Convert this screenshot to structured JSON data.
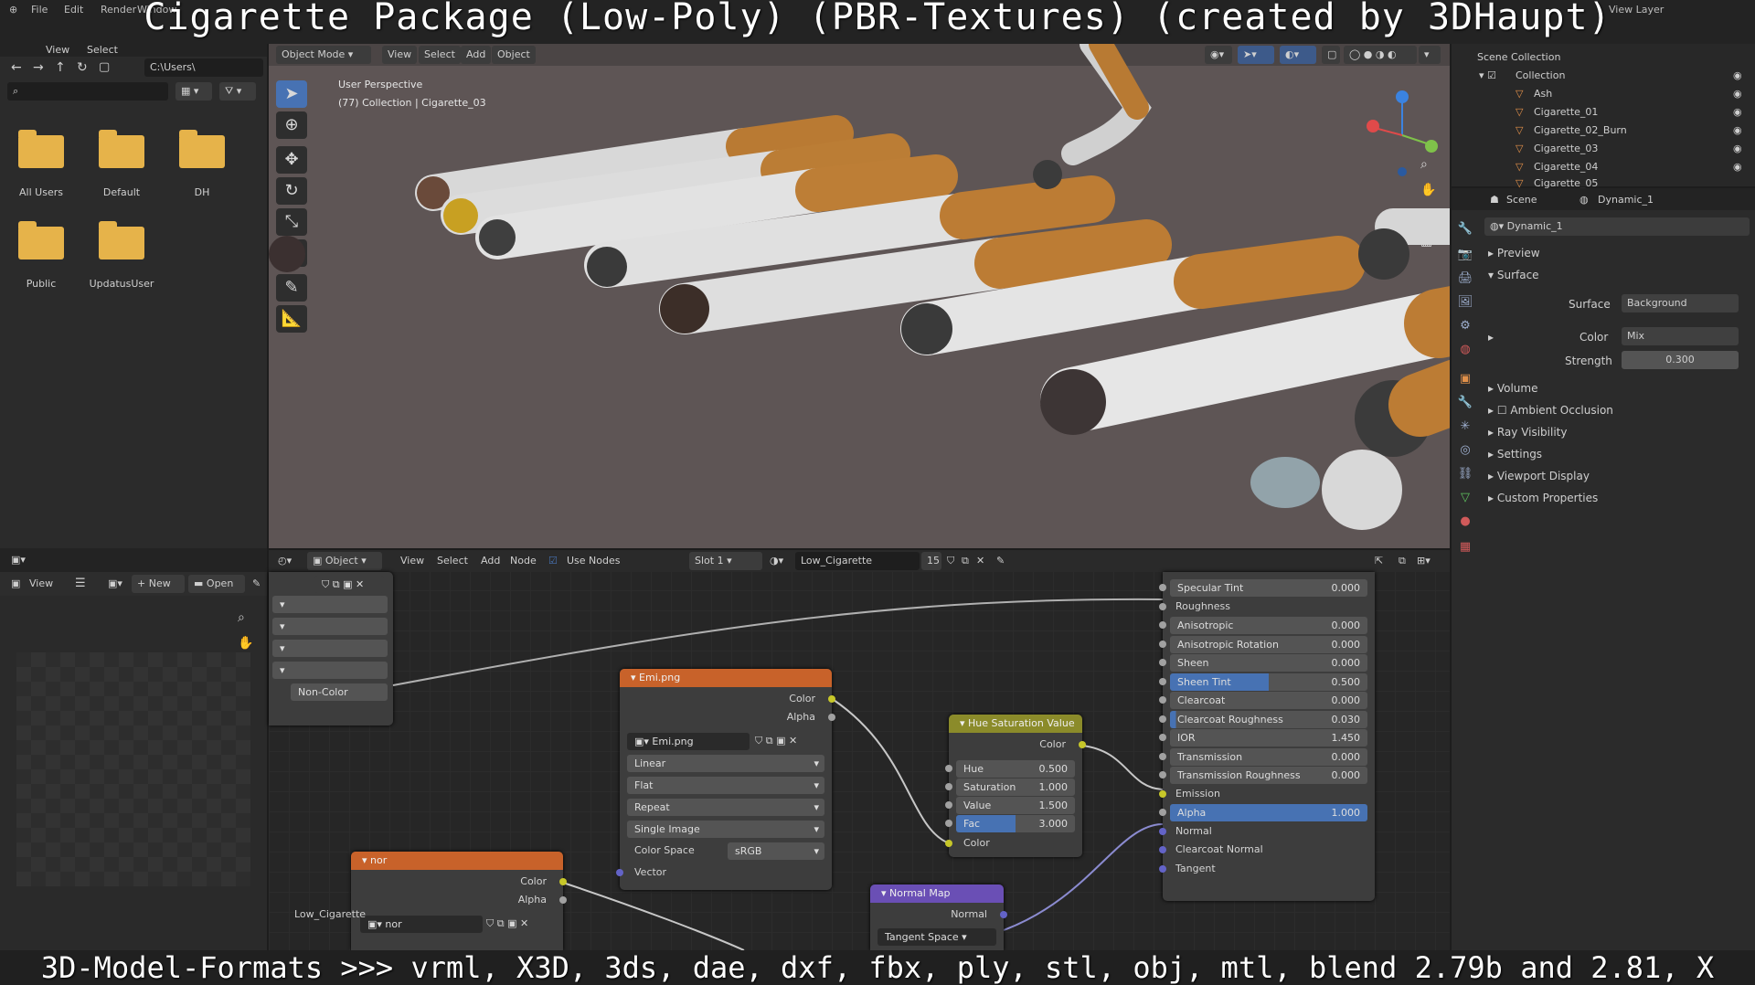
{
  "overlay_title": "Cigarette Package (Low-Poly) (PBR-Textures) (created by 3DHaupt)",
  "overlay_footer": "3D-Model-Formats >>> vrml, X3D, 3ds, dae, dxf, fbx, ply, stl, obj, mtl, blend 2.79b and 2.81, X",
  "topmenu": {
    "file": "File",
    "edit": "Edit",
    "render": "Render",
    "window": "Window",
    "view_layer": "View Layer"
  },
  "filebrowser": {
    "header": {
      "view": "View",
      "select": "Select"
    },
    "path": "C:\\Users\\",
    "folders": [
      "All Users",
      "Default",
      "DH",
      "Public",
      "UpdatusUser"
    ]
  },
  "viewport": {
    "mode": "Object Mode",
    "menus": [
      "View",
      "Select",
      "Add",
      "Object"
    ],
    "perspective": "User Perspective",
    "collection_info": "(77) Collection | Cigarette_03"
  },
  "outliner": {
    "root": "Scene Collection",
    "collection": "Collection",
    "items": [
      "Ash",
      "Cigarette_01",
      "Cigarette_02_Burn",
      "Cigarette_03",
      "Cigarette_04",
      "Cigarette_05"
    ]
  },
  "properties": {
    "scene_tab": "Scene",
    "world_tab": "Dynamic_1",
    "world_name": "Dynamic_1",
    "panels": {
      "preview": "Preview",
      "surface": "Surface",
      "volume": "Volume",
      "ao": "Ambient Occlusion",
      "ray": "Ray Visibility",
      "settings": "Settings",
      "viewport_display": "Viewport Display",
      "custom": "Custom Properties"
    },
    "surface_label": "Surface",
    "surface_value": "Background",
    "color_label": "Color",
    "color_value": "Mix",
    "strength_label": "Strength",
    "strength_value": "0.300"
  },
  "image_editor": {
    "view": "View",
    "new": "New",
    "open": "Open"
  },
  "node_editor": {
    "object": "Object",
    "menus": [
      "View",
      "Select",
      "Add",
      "Node"
    ],
    "use_nodes": "Use Nodes",
    "slot": "Slot 1",
    "material": "Low_Cigarette",
    "users": "15",
    "left_field": "Non-Color",
    "left_label": "Low_Cigarette"
  },
  "node_emi": {
    "title": "Emi.png",
    "out_color": "Color",
    "out_alpha": "Alpha",
    "image": "Emi.png",
    "interp": "Linear",
    "proj": "Flat",
    "ext": "Repeat",
    "source": "Single Image",
    "cs_label": "Color Space",
    "cs_value": "sRGB",
    "vector": "Vector"
  },
  "node_nor": {
    "title": "nor",
    "out_color": "Color",
    "out_alpha": "Alpha",
    "image": "nor"
  },
  "node_hsv": {
    "title": "Hue Saturation Value",
    "out_color": "Color",
    "hue_label": "Hue",
    "hue": "0.500",
    "sat_label": "Saturation",
    "sat": "1.000",
    "val_label": "Value",
    "val": "1.500",
    "fac_label": "Fac",
    "fac": "3.000",
    "in_color": "Color"
  },
  "node_normalmap": {
    "title": "Normal Map",
    "out_normal": "Normal",
    "space": "Tangent Space"
  },
  "bsdf_rows": [
    {
      "label": "Specular Tint",
      "value": "0.000"
    },
    {
      "label": "Roughness",
      "value": ""
    },
    {
      "label": "Anisotropic",
      "value": "0.000"
    },
    {
      "label": "Anisotropic Rotation",
      "value": "0.000"
    },
    {
      "label": "Sheen",
      "value": "0.000"
    },
    {
      "label": "Sheen Tint",
      "value": "0.500"
    },
    {
      "label": "Clearcoat",
      "value": "0.000"
    },
    {
      "label": "Clearcoat Roughness",
      "value": "0.030"
    },
    {
      "label": "IOR",
      "value": "1.450"
    },
    {
      "label": "Transmission",
      "value": "0.000"
    },
    {
      "label": "Transmission Roughness",
      "value": "0.000"
    },
    {
      "label": "Emission",
      "value": ""
    },
    {
      "label": "Alpha",
      "value": "1.000"
    },
    {
      "label": "Normal",
      "value": ""
    },
    {
      "label": "Clearcoat Normal",
      "value": ""
    },
    {
      "label": "Tangent",
      "value": ""
    }
  ],
  "colors": {
    "accent": "#4772b3",
    "image_node": "#c8622a",
    "converter": "#8b8b2a",
    "vector": "#6a4fb5",
    "socket_yellow": "#c7c729",
    "socket_gray": "#a1a1a1",
    "socket_purple": "#6363c7"
  },
  "icons": [
    "search-icon",
    "folder-icon",
    "cursor-icon",
    "move-icon",
    "rotate-icon",
    "scale-icon",
    "transform-icon",
    "annotate-icon",
    "measure-icon",
    "eye-icon",
    "camera-icon",
    "hand-icon",
    "zoom-icon"
  ]
}
